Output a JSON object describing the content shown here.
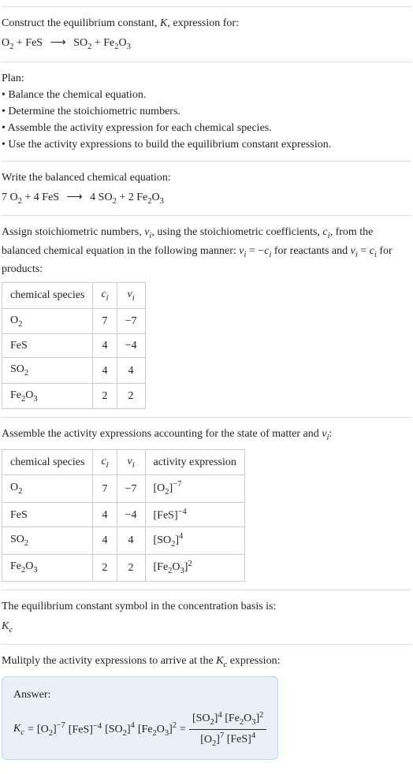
{
  "header": {
    "title_prefix": "Construct the equilibrium constant, ",
    "title_K": "K",
    "title_suffix": ", expression for:"
  },
  "reaction_unbalanced": {
    "r1": "O",
    "r1_sub": "2",
    "plus1": " + ",
    "r2": "FeS",
    "arrow": "⟶",
    "p1": "SO",
    "p1_sub": "2",
    "plus2": " + ",
    "p2": "Fe",
    "p2_sub1": "2",
    "p2_mid": "O",
    "p2_sub2": "3"
  },
  "plan": {
    "heading": "Plan:",
    "items": [
      "Balance the chemical equation.",
      "Determine the stoichiometric numbers.",
      "Assemble the activity expression for each chemical species.",
      "Use the activity expressions to build the equilibrium constant expression."
    ]
  },
  "balanced": {
    "heading": "Write the balanced chemical equation:",
    "c1": "7 ",
    "r1": "O",
    "r1_sub": "2",
    "plus1": " + ",
    "c2": "4 ",
    "r2": "FeS",
    "arrow": "⟶",
    "c3": "4 ",
    "p1": "SO",
    "p1_sub": "2",
    "plus2": " + ",
    "c4": "2 ",
    "p2": "Fe",
    "p2_sub1": "2",
    "p2_mid": "O",
    "p2_sub2": "3"
  },
  "assign": {
    "text1": "Assign stoichiometric numbers, ",
    "nu": "ν",
    "sub_i": "i",
    "text2": ", using the stoichiometric coefficients, ",
    "c": "c",
    "text3": ", from the balanced chemical equation in the following manner: ",
    "eq1a": "ν",
    "eq1b": "i",
    "eq1c": " = −",
    "eq1d": "c",
    "eq1e": "i",
    "text4": " for reactants and ",
    "eq2a": "ν",
    "eq2b": "i",
    "eq2c": " = ",
    "eq2d": "c",
    "eq2e": "i",
    "text5": " for products:"
  },
  "table1": {
    "headers": {
      "h1": "chemical species",
      "h2": "c",
      "h2_sub": "i",
      "h3": "ν",
      "h3_sub": "i"
    },
    "rows": [
      {
        "sp": "O",
        "sp_sub": "2",
        "sp2": "",
        "sp2_sub": "",
        "c": "7",
        "v": "−7"
      },
      {
        "sp": "FeS",
        "sp_sub": "",
        "sp2": "",
        "sp2_sub": "",
        "c": "4",
        "v": "−4"
      },
      {
        "sp": "SO",
        "sp_sub": "2",
        "sp2": "",
        "sp2_sub": "",
        "c": "4",
        "v": "4"
      },
      {
        "sp": "Fe",
        "sp_sub": "2",
        "sp2": "O",
        "sp2_sub": "3",
        "c": "2",
        "v": "2"
      }
    ]
  },
  "assemble": {
    "text1": "Assemble the activity expressions accounting for the state of matter and ",
    "nu": "ν",
    "sub_i": "i",
    "colon": ":"
  },
  "table2": {
    "headers": {
      "h1": "chemical species",
      "h2": "c",
      "h2_sub": "i",
      "h3": "ν",
      "h3_sub": "i",
      "h4": "activity expression"
    },
    "rows": [
      {
        "sp_html": "O<sub>2</sub>",
        "c": "7",
        "v": "−7",
        "ae_base": "[O<sub>2</sub>]",
        "ae_exp": "−7"
      },
      {
        "sp_html": "FeS",
        "c": "4",
        "v": "−4",
        "ae_base": "[FeS]",
        "ae_exp": "−4"
      },
      {
        "sp_html": "SO<sub>2</sub>",
        "c": "4",
        "v": "4",
        "ae_base": "[SO<sub>2</sub>]",
        "ae_exp": "4"
      },
      {
        "sp_html": "Fe<sub>2</sub>O<sub>3</sub>",
        "c": "2",
        "v": "2",
        "ae_base": "[Fe<sub>2</sub>O<sub>3</sub>]",
        "ae_exp": "2"
      }
    ]
  },
  "symbol": {
    "text": "The equilibrium constant symbol in the concentration basis is:",
    "K": "K",
    "sub": "c"
  },
  "multiply": {
    "text1": "Mulitply the activity expressions to arrive at the ",
    "K": "K",
    "sub": "c",
    "text2": " expression:"
  },
  "answer": {
    "label": "Answer:",
    "lhs_K": "K",
    "lhs_sub": "c",
    "eq": " = ",
    "t1_base": "[O<sub>2</sub>]",
    "t1_exp": "−7",
    "t2_base": "[FeS]",
    "t2_exp": "−4",
    "t3_base": "[SO<sub>2</sub>]",
    "t3_exp": "4",
    "t4_base": "[Fe<sub>2</sub>O<sub>3</sub>]",
    "t4_exp": "2",
    "eq2": " = ",
    "num1_base": "[SO<sub>2</sub>]",
    "num1_exp": "4",
    "num2_base": "[Fe<sub>2</sub>O<sub>3</sub>]",
    "num2_exp": "2",
    "den1_base": "[O<sub>2</sub>]",
    "den1_exp": "7",
    "den2_base": "[FeS]",
    "den2_exp": "4"
  }
}
